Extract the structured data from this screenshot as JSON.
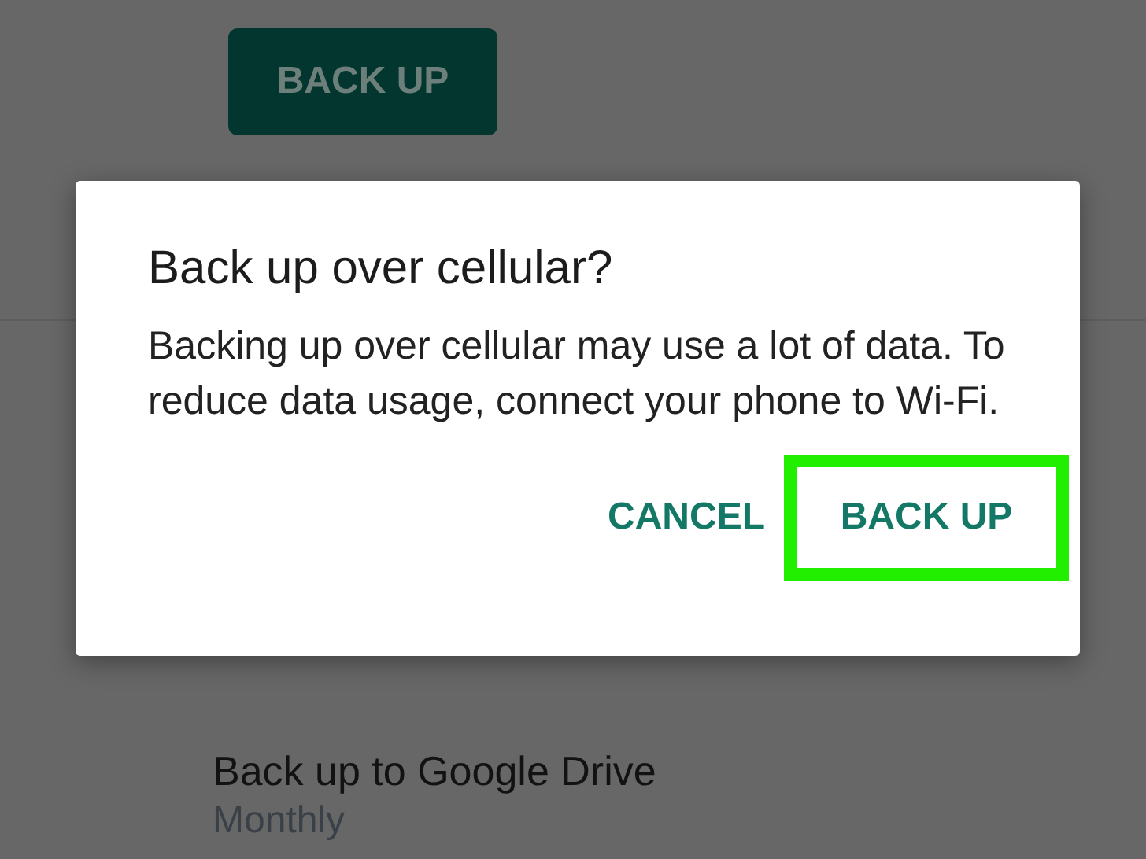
{
  "background": {
    "button": "BACK UP",
    "list_item": {
      "title": "Back up to Google Drive",
      "subtitle": "Monthly"
    }
  },
  "dialog": {
    "title": "Back up over cellular?",
    "message": "Backing up over cellular may use a lot of data. To reduce data usage, connect your phone to Wi-Fi.",
    "buttons": [
      {
        "label": "CANCEL",
        "highlighted": false
      },
      {
        "label": "BACK UP",
        "highlighted": true
      }
    ]
  }
}
